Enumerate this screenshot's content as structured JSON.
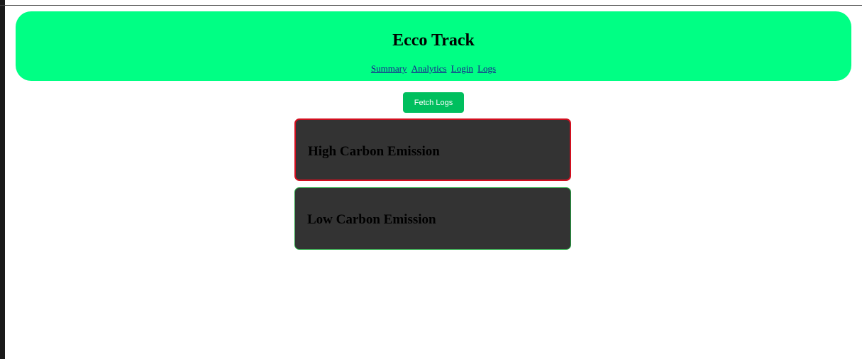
{
  "header": {
    "title": "Ecco Track",
    "nav": [
      "Summary",
      "Analytics",
      "Login",
      "Logs"
    ]
  },
  "actions": {
    "fetch_label": "Fetch Logs"
  },
  "cards": [
    {
      "title": "High Carbon Emission",
      "border_color": "#d10f1f"
    },
    {
      "title": "Low Carbon Emission",
      "border_color": "#23a63f"
    }
  ],
  "colors": {
    "header_bg": "#00ff84",
    "button_bg": "#00bf5e",
    "card_bg": "#333333"
  }
}
